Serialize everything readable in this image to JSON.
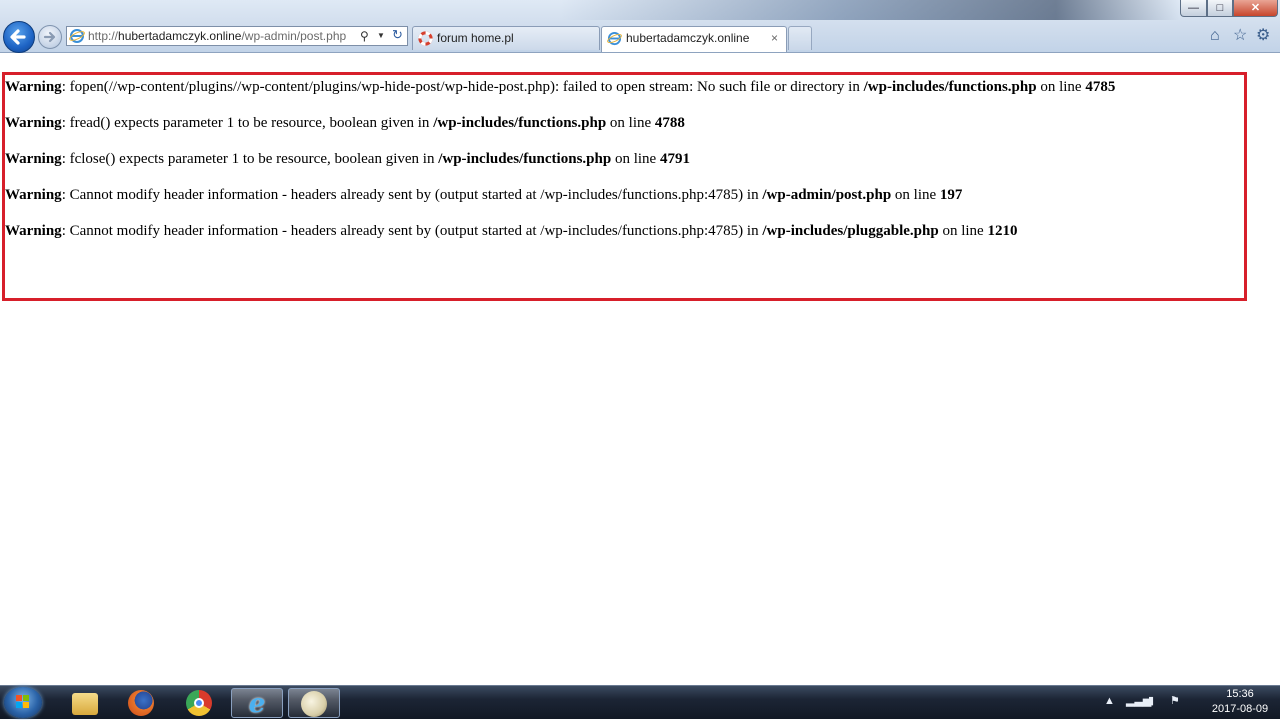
{
  "browser": {
    "address": {
      "scheme": "http://",
      "host": "hubertadamczyk.online",
      "path": "/wp-admin/post.php"
    },
    "tabs": [
      {
        "label": "forum home.pl"
      },
      {
        "label": "hubertadamczyk.online",
        "close_label": "×"
      }
    ]
  },
  "page": {
    "warnings": [
      {
        "label": "Warning",
        "parts": [
          ": fopen(//wp-content/plugins//wp-content/plugins/wp-hide-post/wp-hide-post.php): failed to open stream: No such file or directory in ",
          "/wp-includes/functions.php",
          " on line ",
          "4785"
        ]
      },
      {
        "label": "Warning",
        "parts": [
          ": fread() expects parameter 1 to be resource, boolean given in ",
          "/wp-includes/functions.php",
          " on line ",
          "4788"
        ]
      },
      {
        "label": "Warning",
        "parts": [
          ": fclose() expects parameter 1 to be resource, boolean given in ",
          "/wp-includes/functions.php",
          " on line ",
          "4791"
        ]
      },
      {
        "label": "Warning",
        "parts": [
          ": Cannot modify header information - headers already sent by (output started at /wp-includes/functions.php:4785) in ",
          "/wp-admin/post.php",
          " on line ",
          "197"
        ]
      },
      {
        "label": "Warning",
        "parts": [
          ": Cannot modify header information - headers already sent by (output started at /wp-includes/functions.php:4785) in ",
          "/wp-includes/pluggable.php",
          " on line ",
          "1210"
        ]
      }
    ],
    "highlight_color": "#d71f2a"
  },
  "taskbar": {
    "apps": [
      "file-explorer-icon",
      "firefox-icon",
      "chrome-icon",
      "internet-explorer-icon",
      "paint-icon"
    ],
    "active_app": "internet-explorer-icon",
    "clock": {
      "time": "15:36",
      "date": "2017-08-09"
    }
  }
}
